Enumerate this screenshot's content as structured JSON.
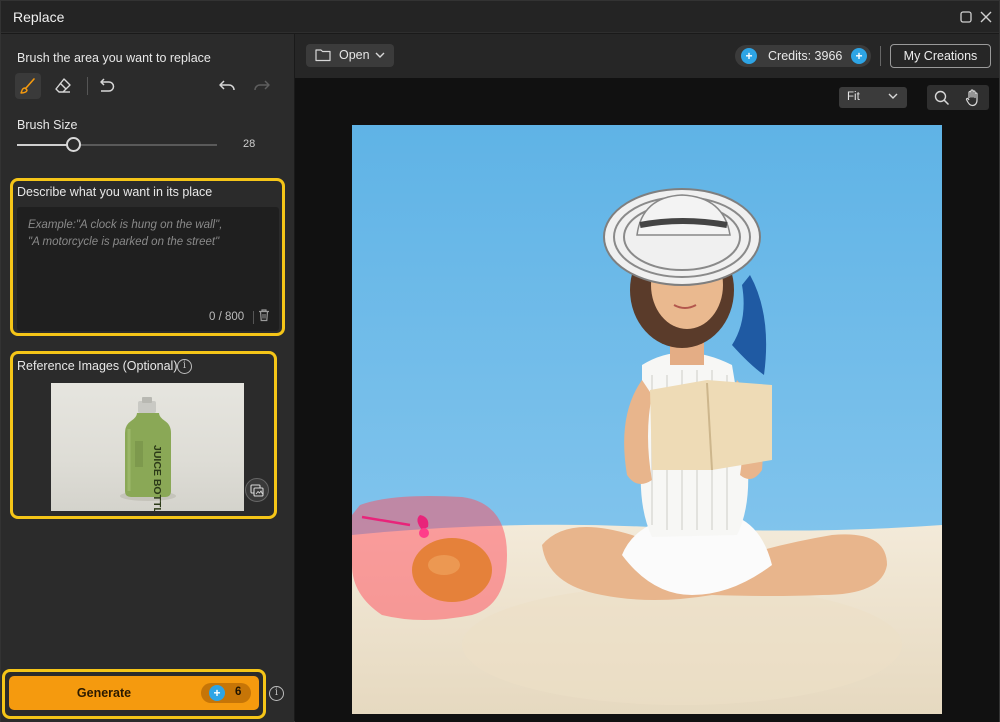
{
  "window": {
    "title": "Replace"
  },
  "left": {
    "brush_heading": "Brush the area you want to replace",
    "brush_size_label": "Brush Size",
    "brush_size_value": "28",
    "brush_size_fraction": 0.28,
    "describe_heading": "Describe what you want in its place",
    "describe_placeholder": "Example:\"A clock is hung on the wall\",\n\"A motorcycle is parked on the street\"",
    "char_count": "0 / 800",
    "reference_heading": "Reference Images (Optional)",
    "reference_image_text": "JUICE BOTTLE",
    "generate_label": "Generate",
    "generate_cost": "6"
  },
  "toolbar": {
    "open_label": "Open",
    "credits_label": "Credits: 3966",
    "my_creations_label": "My Creations",
    "zoom_select": "Fit"
  },
  "colors": {
    "accent": "#f59a0e",
    "highlight": "#f5c518",
    "credit_icon": "#2ea5e6",
    "mask": "#ff4d5e"
  },
  "icons": [
    "brush-icon",
    "eraser-icon",
    "reset-icon",
    "undo-icon",
    "redo-icon",
    "folder-icon",
    "chevron-down-icon",
    "credit-icon",
    "add-credit-icon",
    "search-icon",
    "hand-icon",
    "trash-icon",
    "info-icon",
    "swap-image-icon",
    "maximize-icon",
    "close-icon"
  ]
}
